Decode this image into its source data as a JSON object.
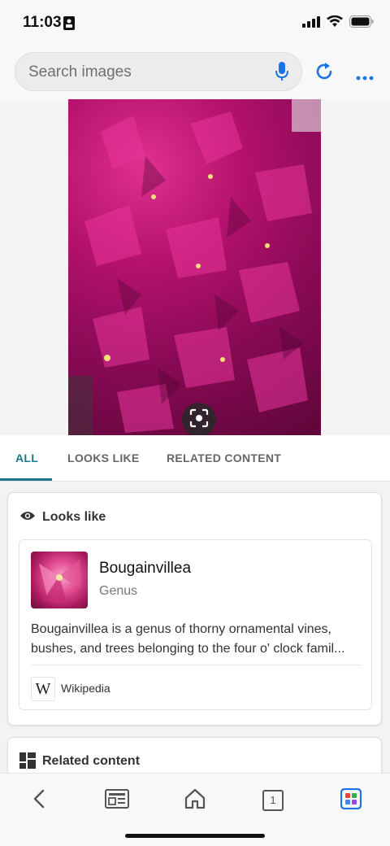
{
  "status_bar": {
    "time": "11:03"
  },
  "search": {
    "placeholder": "Search images"
  },
  "tabs": [
    {
      "label": "ALL",
      "active": true
    },
    {
      "label": "LOOKS LIKE",
      "active": false
    },
    {
      "label": "RELATED CONTENT",
      "active": false
    }
  ],
  "looks_like": {
    "title": "Looks like",
    "entity": {
      "name": "Bougainvillea",
      "type": "Genus",
      "description": "Bougainvillea is a genus of thorny ornamental vines, bushes, and trees belonging to the four o' clock famil...",
      "source": "Wikipedia",
      "source_glyph": "W"
    }
  },
  "related_content": {
    "title": "Related content"
  },
  "bottom_nav": {
    "tab_count": "1"
  },
  "colors": {
    "accent": "#1a7a8c",
    "link_blue": "#1a73e8",
    "flower_magenta": "#b5126e"
  }
}
